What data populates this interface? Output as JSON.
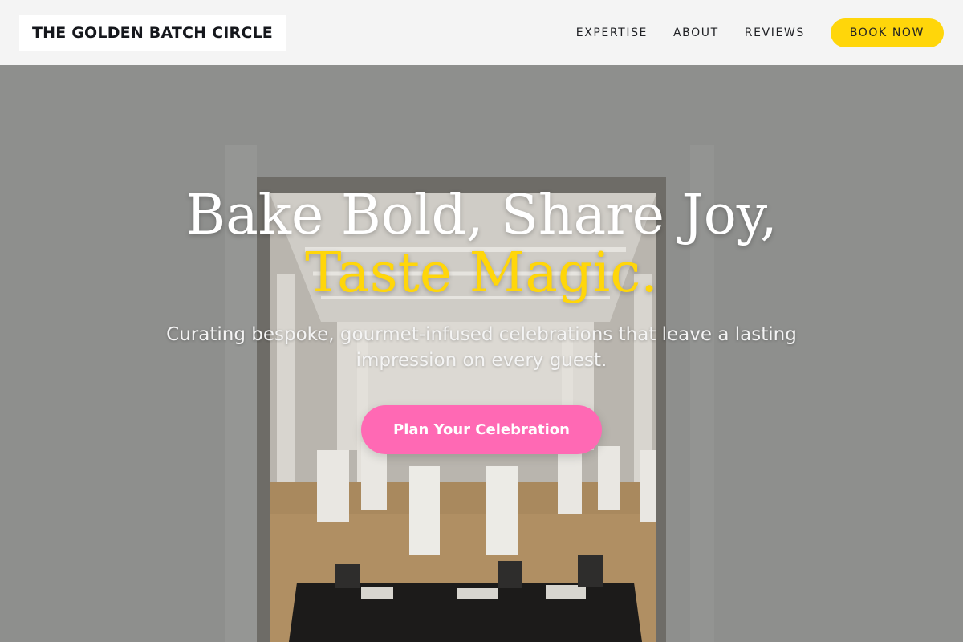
{
  "header": {
    "brand": "THE GOLDEN BATCH CIRCLE",
    "nav": [
      {
        "label": "EXPERTISE"
      },
      {
        "label": "ABOUT"
      },
      {
        "label": "REVIEWS"
      }
    ],
    "book_label": "BOOK NOW"
  },
  "hero": {
    "headline_main": "Bake Bold, Share Joy, ",
    "headline_accent": "Taste Magic.",
    "subtitle": "Curating bespoke, gourmet-infused celebrations that leave a lasting impression on every guest.",
    "cta_label": "Plan Your Celebration",
    "background_image": "photo of an event hall with white pillars, stacked book display carts and a black table seen through an open doorway"
  },
  "colors": {
    "accent": "#ffd60a",
    "cta": "#ff69b4",
    "header_bg": "#f4f4f4",
    "text_dark": "#15171c"
  }
}
